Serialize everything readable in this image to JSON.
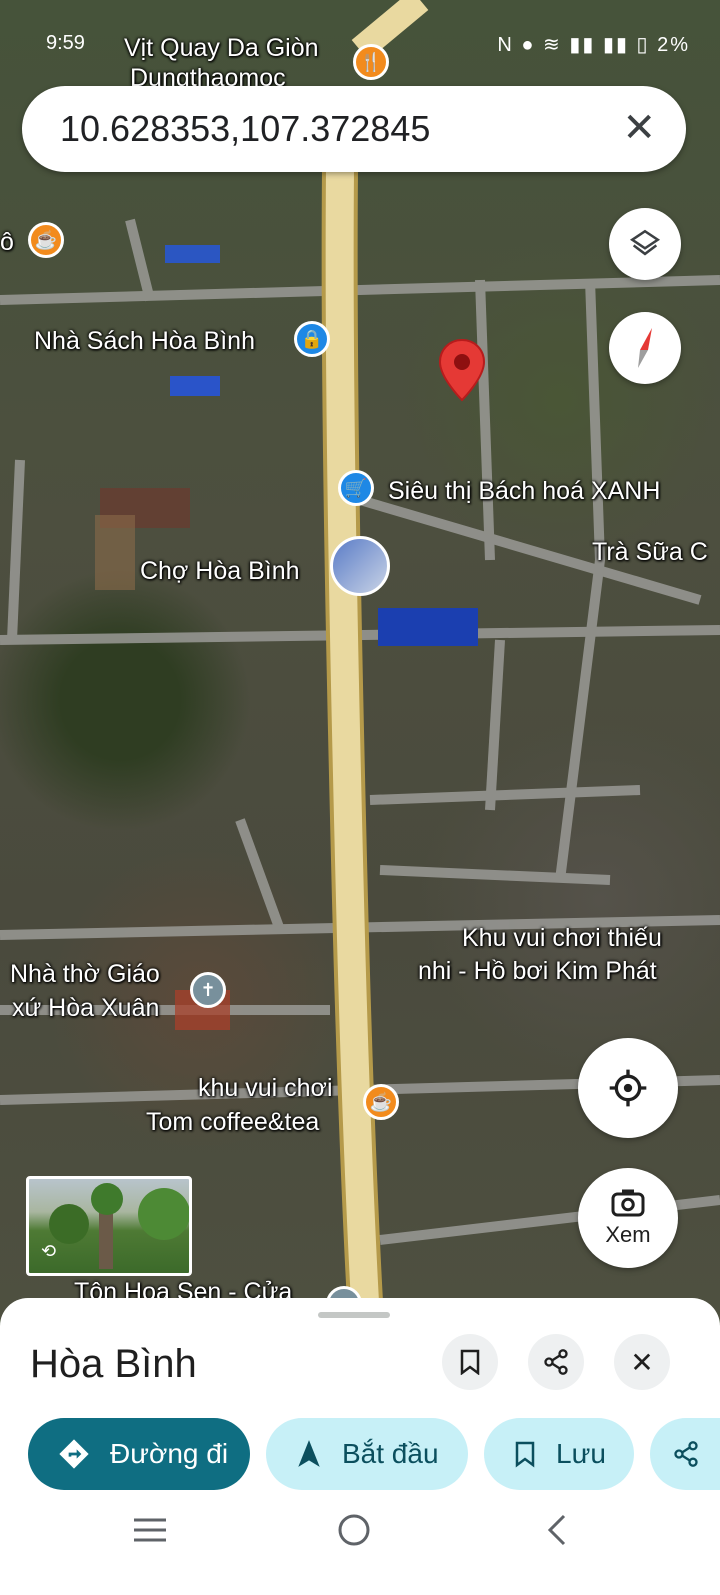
{
  "status_bar": {
    "time": "9:59",
    "battery": "2%"
  },
  "search": {
    "coords": "10.628353,107.372845"
  },
  "map_labels": {
    "vit_quay": "Vịt Quay Da Giòn",
    "vit_quay2": "Dungthaomoc",
    "nha_sach": "Nhà Sách Hòa Bình",
    "sieu_thi": "Siêu thị Bách hoá XANH",
    "tra_sua": "Trà Sữa C",
    "cho": "Chợ Hòa Bình",
    "khu_vui_1": "Khu vui chơi thiếu",
    "khu_vui_2": "nhi - Hồ bơi Kim Phát",
    "nha_tho_1": "Nhà thờ Giáo",
    "nha_tho_2": "xứ Hòa Xuân",
    "tom_1": "khu vui chơi",
    "tom_2": "Tom coffee&tea",
    "ton": "Tôn Hoa Sen - Cửa",
    "left_cut": "ô"
  },
  "controls": {
    "xem": "Xem"
  },
  "sheet": {
    "place_name": "Hòa Bình",
    "directions": "Đường đi",
    "start": "Bắt đầu",
    "save": "Lưu"
  },
  "colors": {
    "primary": "#0f6e82",
    "secondary": "#c7f0f7",
    "pin": "#e53935",
    "road": "#e9d9a0"
  }
}
